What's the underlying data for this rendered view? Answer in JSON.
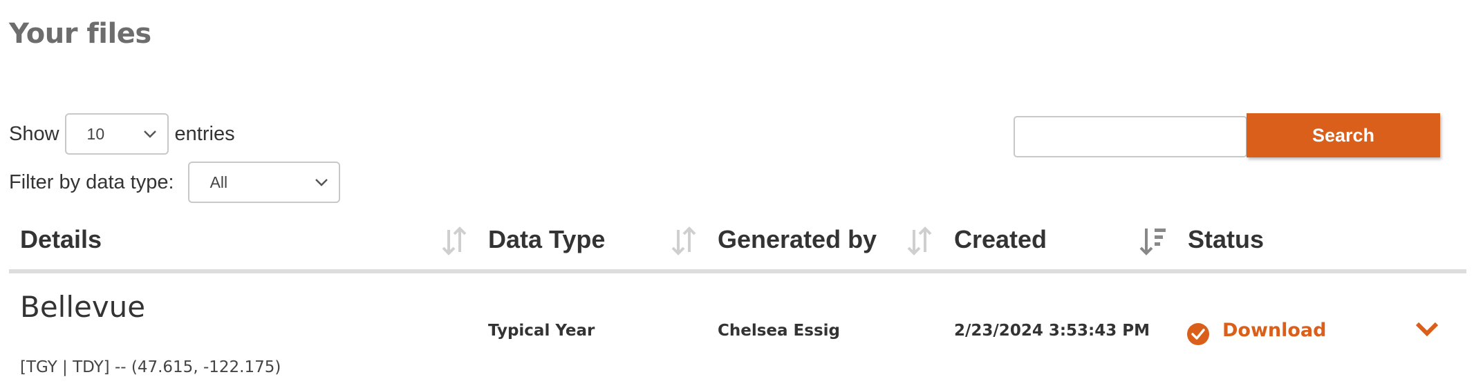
{
  "page": {
    "title": "Your files"
  },
  "length_control": {
    "show_label": "Show",
    "value": "10",
    "suffix_label": "entries"
  },
  "filter": {
    "label": "Filter by data type:",
    "value": "All"
  },
  "search": {
    "placeholder": "",
    "button_label": "Search"
  },
  "table": {
    "columns": [
      {
        "label": "Details",
        "sort": "unsorted"
      },
      {
        "label": "Data Type",
        "sort": "unsorted"
      },
      {
        "label": "Generated by",
        "sort": "unsorted"
      },
      {
        "label": "Created",
        "sort": "descending"
      },
      {
        "label": "Status",
        "sort": "none"
      }
    ],
    "rows": [
      {
        "name": "Bellevue",
        "details": "[TGY | TDY] -- (47.615, -122.175)",
        "data_type": "Typical Year",
        "generated_by": "Chelsea Essig",
        "created": "2/23/2024 3:53:43 PM",
        "status_icon": "check-circle-icon",
        "status_action": "Download"
      }
    ]
  },
  "colors": {
    "accent": "#d95f1a",
    "title_gray": "#6d6d6d",
    "border": "#c8c8c8",
    "rule": "#dddddd"
  }
}
